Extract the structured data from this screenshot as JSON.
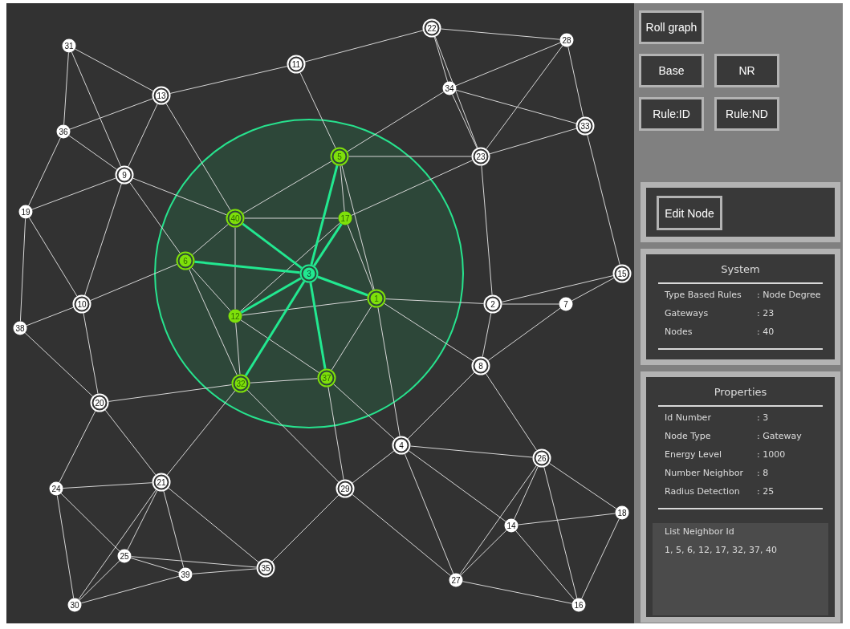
{
  "graph": {
    "nodes": [
      {
        "label": "1",
        "kind": "gateway",
        "selected": false,
        "highlighted": true
      },
      {
        "label": "2",
        "kind": "gateway",
        "selected": false,
        "highlighted": false
      },
      {
        "label": "3",
        "kind": "gateway",
        "selected": true,
        "highlighted": false
      },
      {
        "label": "4",
        "kind": "gateway",
        "selected": false,
        "highlighted": false
      },
      {
        "label": "5",
        "kind": "gateway",
        "selected": false,
        "highlighted": true
      },
      {
        "label": "6",
        "kind": "gateway",
        "selected": false,
        "highlighted": true
      },
      {
        "label": "7",
        "kind": "node",
        "selected": false,
        "highlighted": false
      },
      {
        "label": "8",
        "kind": "gateway",
        "selected": false,
        "highlighted": false
      },
      {
        "label": "9",
        "kind": "gateway",
        "selected": false,
        "highlighted": false
      },
      {
        "label": "10",
        "kind": "gateway",
        "selected": false,
        "highlighted": false
      },
      {
        "label": "11",
        "kind": "gateway",
        "selected": false,
        "highlighted": false
      },
      {
        "label": "12",
        "kind": "node",
        "selected": false,
        "highlighted": true
      },
      {
        "label": "13",
        "kind": "gateway",
        "selected": false,
        "highlighted": false
      },
      {
        "label": "14",
        "kind": "node",
        "selected": false,
        "highlighted": false
      },
      {
        "label": "15",
        "kind": "gateway",
        "selected": false,
        "highlighted": false
      },
      {
        "label": "16",
        "kind": "node",
        "selected": false,
        "highlighted": false
      },
      {
        "label": "17",
        "kind": "node",
        "selected": false,
        "highlighted": true
      },
      {
        "label": "18",
        "kind": "node",
        "selected": false,
        "highlighted": false
      },
      {
        "label": "19",
        "kind": "node",
        "selected": false,
        "highlighted": false
      },
      {
        "label": "20",
        "kind": "gateway",
        "selected": false,
        "highlighted": false
      },
      {
        "label": "21",
        "kind": "gateway",
        "selected": false,
        "highlighted": false
      },
      {
        "label": "22",
        "kind": "gateway",
        "selected": false,
        "highlighted": false
      },
      {
        "label": "23",
        "kind": "gateway",
        "selected": false,
        "highlighted": false
      },
      {
        "label": "24",
        "kind": "node",
        "selected": false,
        "highlighted": false
      },
      {
        "label": "25",
        "kind": "node",
        "selected": false,
        "highlighted": false
      },
      {
        "label": "26",
        "kind": "gateway",
        "selected": false,
        "highlighted": false
      },
      {
        "label": "27",
        "kind": "node",
        "selected": false,
        "highlighted": false
      },
      {
        "label": "28",
        "kind": "node",
        "selected": false,
        "highlighted": false
      },
      {
        "label": "29",
        "kind": "gateway",
        "selected": false,
        "highlighted": false
      },
      {
        "label": "30",
        "kind": "node",
        "selected": false,
        "highlighted": false
      },
      {
        "label": "31",
        "kind": "node",
        "selected": false,
        "highlighted": false
      },
      {
        "label": "32",
        "kind": "gateway",
        "selected": false,
        "highlighted": true
      },
      {
        "label": "33",
        "kind": "gateway",
        "selected": false,
        "highlighted": false
      },
      {
        "label": "34",
        "kind": "node",
        "selected": false,
        "highlighted": false
      },
      {
        "label": "35",
        "kind": "gateway",
        "selected": false,
        "highlighted": false
      },
      {
        "label": "36",
        "kind": "node",
        "selected": false,
        "highlighted": false
      },
      {
        "label": "37",
        "kind": "gateway",
        "selected": false,
        "highlighted": true
      },
      {
        "label": "38",
        "kind": "node",
        "selected": false,
        "highlighted": false
      },
      {
        "label": "39",
        "kind": "node",
        "selected": false,
        "highlighted": false
      },
      {
        "label": "40",
        "kind": "gateway",
        "selected": false,
        "highlighted": true
      }
    ]
  },
  "controls": {
    "button_rows": [
      [
        "Roll graph"
      ],
      [
        "Base",
        "NR"
      ],
      [
        "Rule:ID",
        "Rule:ND"
      ]
    ]
  },
  "edit_panel": {
    "button": "Edit Node"
  },
  "system": {
    "title": "System",
    "rows": [
      {
        "label": "Type Based Rules",
        "value": ": Node Degree"
      },
      {
        "label": "Gateways",
        "value": ": 23"
      },
      {
        "label": "Nodes",
        "value": ": 40"
      }
    ]
  },
  "properties": {
    "title": "Properties",
    "rows": [
      {
        "label": "Id Number",
        "value": ": 3"
      },
      {
        "label": "Node Type",
        "value": ": Gateway"
      },
      {
        "label": "Energy Level",
        "value": ": 1000"
      },
      {
        "label": "Number Neighbor",
        "value": ": 8"
      },
      {
        "label": "Radius Detection",
        "value": ": 25"
      }
    ],
    "neighbor_list": {
      "title": "List Neighbor Id",
      "value": "1, 5, 6, 12, 17, 32, 37, 40"
    }
  }
}
